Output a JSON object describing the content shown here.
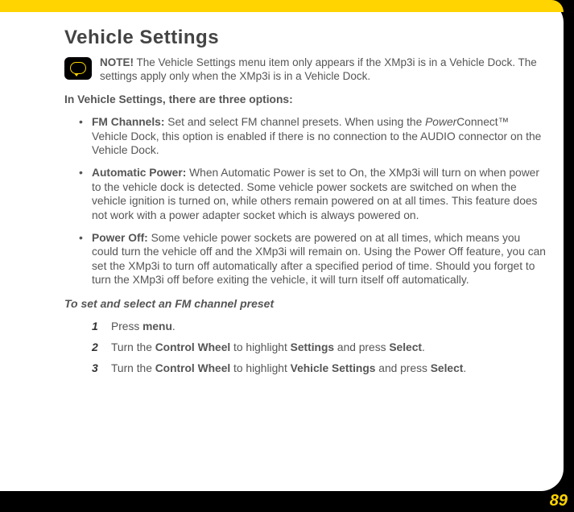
{
  "title": "Vehicle Settings",
  "note": {
    "label": "NOTE!",
    "text": "The Vehicle Settings menu item only appears if the XMp3i is in a Vehicle Dock. The settings apply only when the XMp3i is in a Vehicle Dock."
  },
  "intro": "In Vehicle Settings, there are three options:",
  "options": [
    {
      "label": "FM Channels:",
      "prefix_i": "Power",
      "prefix_rest": "Connect™ Vehicle Dock, this option is enabled if there is no connection to the AUDIO connector on the Vehicle Dock.",
      "lead": "Set and select FM channel presets. When using the "
    },
    {
      "label": "Automatic Power:",
      "text": "When Automatic Power is set to On, the XMp3i will turn on when power to the vehicle dock is detected. Some vehicle power sockets are switched on when the vehicle ignition is turned on, while others remain powered on at all times. This feature does not work with a power adapter socket which is always powered on."
    },
    {
      "label": "Power Off:",
      "text": "Some vehicle power sockets are powered on at all times, which means you could turn the vehicle off and the XMp3i will remain on. Using the Power Off feature, you can set the XMp3i to turn off automatically after a specified period of time. Should you forget to turn the XMp3i off before exiting the vehicle, it will turn itself off automatically."
    }
  ],
  "subhead": "To set and select an FM channel preset",
  "steps": [
    {
      "num": "1",
      "pre": "Press ",
      "b1": "menu",
      "post": "."
    },
    {
      "num": "2",
      "pre": "Turn the ",
      "b1": "Control Wheel",
      "mid": " to highlight ",
      "b2": "Settings",
      "mid2": " and press ",
      "b3": "Select",
      "post": "."
    },
    {
      "num": "3",
      "pre": "Turn the ",
      "b1": "Control Wheel",
      "mid": " to highlight ",
      "b2": "Vehicle Settings",
      "mid2": " and press ",
      "b3": "Select",
      "post": "."
    }
  ],
  "page_number": "89"
}
